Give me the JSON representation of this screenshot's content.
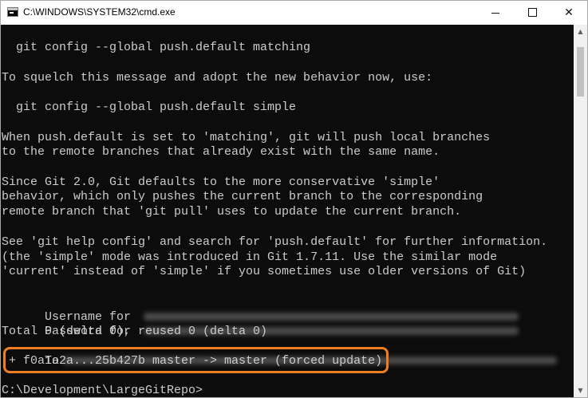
{
  "window": {
    "title": "C:\\WINDOWS\\SYSTEM32\\cmd.exe",
    "minimize_glyph": "",
    "maximize_glyph": "",
    "close_glyph": "✕"
  },
  "console": {
    "lines": [
      "  git config --global push.default matching",
      "To squelch this message and adopt the new behavior now, use:",
      "  git config --global push.default simple",
      "When push.default is set to 'matching', git will push local branches",
      "to the remote branches that already exist with the same name.",
      "Since Git 2.0, Git defaults to the more conservative 'simple'",
      "behavior, which only pushes the current branch to the corresponding",
      "remote branch that 'git pull' uses to update the current branch.",
      "See 'git help config' and search for 'push.default' for further information.",
      "(the 'simple' mode was introduced in Git 1.7.11. Use the similar mode",
      "'current' instead of 'simple' if you sometimes use older versions of Git)",
      "Username for",
      "Password for",
      "Total 0 (delta 0), reused 0 (delta 0)",
      "To",
      " + f0a1a2a...25b427b master -> master (forced update)",
      "C:\\Development\\LargeGitRepo>"
    ]
  },
  "scrollbar": {
    "up_glyph": "▲",
    "down_glyph": "▼"
  },
  "colors": {
    "console_bg": "#0c0c0c",
    "console_text": "#cccccc",
    "highlight": "#f07d20"
  }
}
